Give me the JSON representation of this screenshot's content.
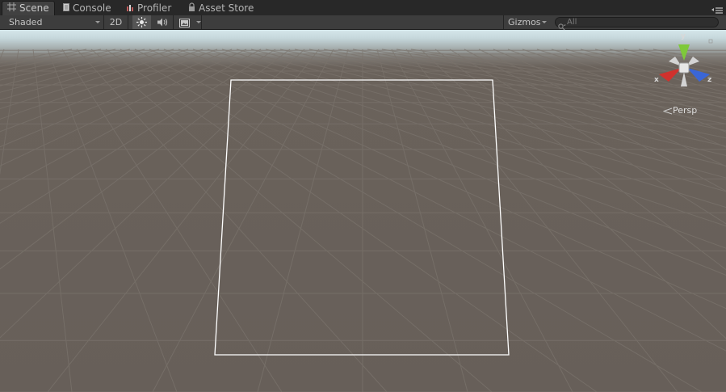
{
  "tabs": [
    {
      "label": "Scene",
      "icon": "grid-icon",
      "active": true
    },
    {
      "label": "Console",
      "icon": "console-icon",
      "active": false
    },
    {
      "label": "Profiler",
      "icon": "profiler-icon",
      "active": false
    },
    {
      "label": "Asset Store",
      "icon": "lock-icon",
      "active": false
    }
  ],
  "toolbar": {
    "shading_mode": "Shaded",
    "mode_2d": "2D",
    "lighting_icon": "sun-icon",
    "audio_icon": "speaker-icon",
    "effects_icon": "image-icon",
    "gizmos_label": "Gizmos",
    "search_placeholder": "All"
  },
  "viewport": {
    "projection_label": "Persp",
    "axis_x": "x",
    "axis_y": "y",
    "axis_z": "z",
    "colors": {
      "axis_x": "#d0312d",
      "axis_y": "#7ec93a",
      "axis_z": "#3a66d6",
      "selection_outline": "#ffffff"
    }
  }
}
